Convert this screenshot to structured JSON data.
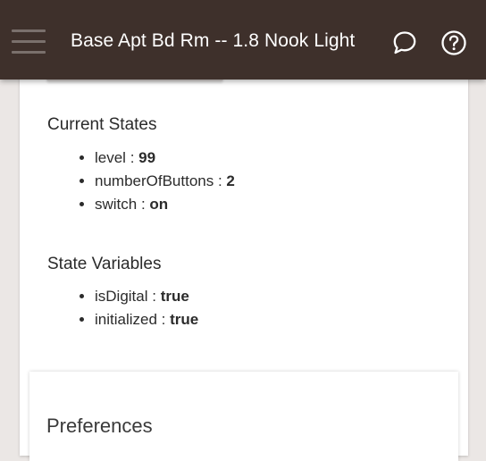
{
  "header": {
    "title": "Base Apt Bd Rm -- 1.8 Nook Light"
  },
  "current_states": {
    "heading": "Current States",
    "items": [
      {
        "key": "level",
        "sep": " : ",
        "value": "99"
      },
      {
        "key": "numberOfButtons",
        "sep": " : ",
        "value": "2"
      },
      {
        "key": "switch",
        "sep": " : ",
        "value": "on"
      }
    ]
  },
  "state_variables": {
    "heading": "State Variables",
    "items": [
      {
        "key": "isDigital",
        "sep": " : ",
        "value": "true"
      },
      {
        "key": "initialized",
        "sep": " : ",
        "value": "true"
      }
    ]
  },
  "preferences": {
    "heading": "Preferences"
  },
  "icons": {
    "menu": "hamburger-menu-icon",
    "chat": "chat-bubble-icon",
    "help": "help-circle-icon"
  },
  "colors": {
    "header_bg": "#3e302b",
    "page_bg": "#ebe7e5",
    "card_bg": "#ffffff"
  }
}
